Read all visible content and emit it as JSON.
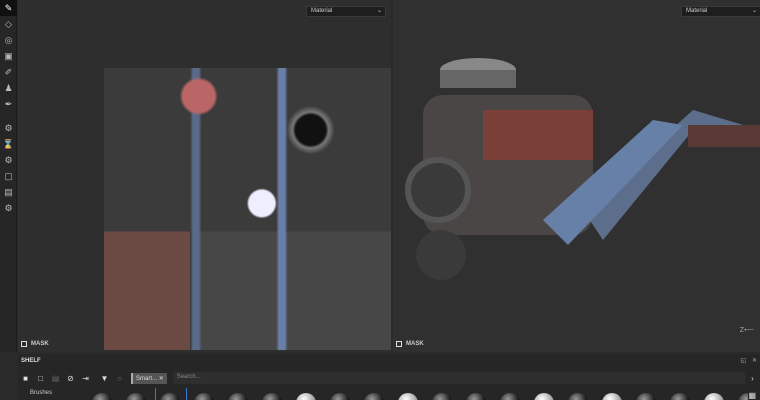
{
  "toolbar": {
    "tools": [
      "paint-brush",
      "eraser",
      "projection",
      "geometry-mask",
      "smudge",
      "clone-stamp",
      "color-picker",
      "bake",
      "history",
      "settings",
      "photoshop-export",
      "document",
      "plugin"
    ]
  },
  "viewport_2d": {
    "mode": "Material",
    "mask_label": "MASK"
  },
  "viewport_3d": {
    "mode": "Material",
    "mask_label": "MASK"
  },
  "shelf": {
    "title": "SHELF",
    "filter_chip": "Smart...",
    "search_placeholder": "Search...",
    "category": "Brushes"
  },
  "colors": {
    "selection": "#3a7ad0",
    "panel": "#262626",
    "viewport": "#2e2e2e"
  }
}
